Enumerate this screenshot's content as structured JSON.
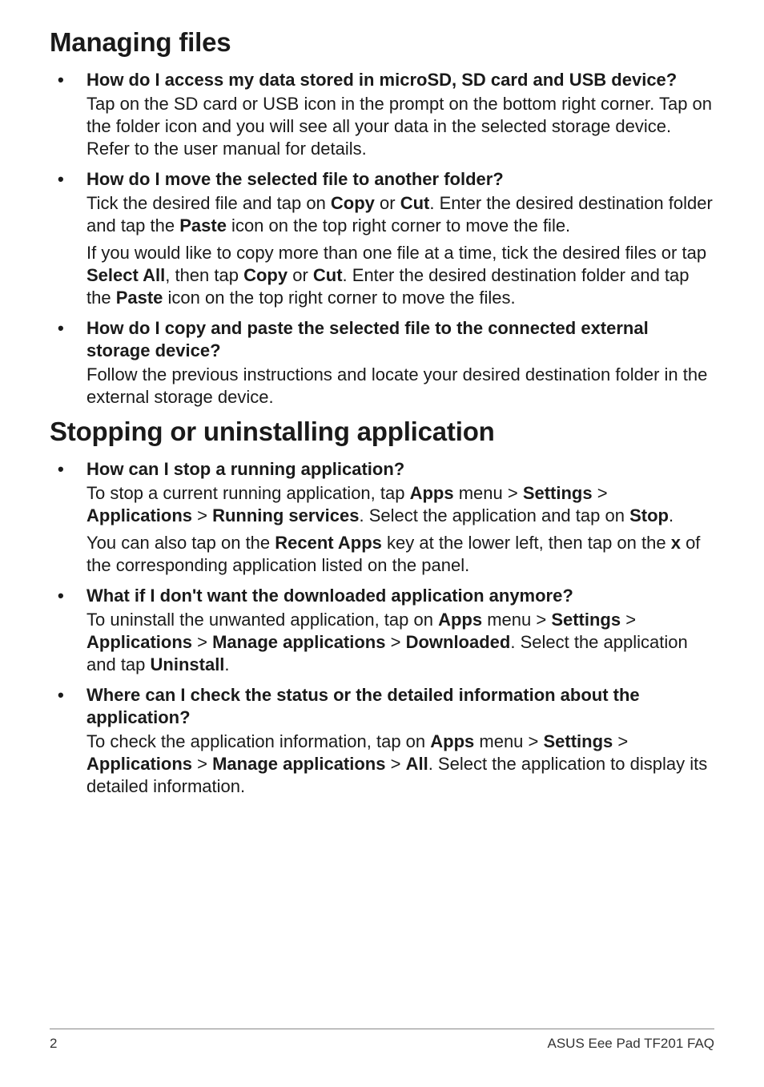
{
  "sections": [
    {
      "heading": "Managing files",
      "items": [
        {
          "q": "How do I access my data stored in microSD, SD card and USB device?",
          "paras": [
            [
              {
                "t": "Tap on the SD card or USB icon in the prompt on the bottom right corner. Tap on the folder icon and you will see all your data in the selected storage device. Refer to the user manual for details."
              }
            ]
          ]
        },
        {
          "q": "How do I move the selected file to another folder?",
          "paras": [
            [
              {
                "t": "Tick the desired file and tap on "
              },
              {
                "t": "Copy",
                "b": true
              },
              {
                "t": " or "
              },
              {
                "t": "Cut",
                "b": true
              },
              {
                "t": ". Enter the desired destination folder and tap the "
              },
              {
                "t": "Paste",
                "b": true
              },
              {
                "t": " icon on the top right corner to move the file."
              }
            ],
            [
              {
                "t": "If you would like to copy more than one file at a time, tick the desired files or tap "
              },
              {
                "t": "Select All",
                "b": true
              },
              {
                "t": ", then tap "
              },
              {
                "t": "Copy",
                "b": true
              },
              {
                "t": " or "
              },
              {
                "t": "Cut",
                "b": true
              },
              {
                "t": ". Enter the desired destination folder and tap the "
              },
              {
                "t": "Paste",
                "b": true
              },
              {
                "t": " icon on the top right corner to move the files."
              }
            ]
          ]
        },
        {
          "q": "How do I copy and paste the selected file to the connected external storage device?",
          "paras": [
            [
              {
                "t": "Follow the previous instructions and locate your desired destination folder in the external storage device."
              }
            ]
          ]
        }
      ]
    },
    {
      "heading": "Stopping or uninstalling application",
      "items": [
        {
          "q": "How can I stop a running application?",
          "paras": [
            [
              {
                "t": "To stop a current running application, tap "
              },
              {
                "t": "Apps",
                "b": true
              },
              {
                "t": " menu > "
              },
              {
                "t": "Settings",
                "b": true
              },
              {
                "t": " > "
              },
              {
                "t": "Applications",
                "b": true
              },
              {
                "t": " > "
              },
              {
                "t": "Running services",
                "b": true
              },
              {
                "t": ". Select the application and tap on "
              },
              {
                "t": "Stop",
                "b": true
              },
              {
                "t": "."
              }
            ],
            [
              {
                "t": "You can also tap on the "
              },
              {
                "t": "Recent Apps",
                "b": true
              },
              {
                "t": " key at the lower left, then tap on the "
              },
              {
                "t": "x",
                "b": true
              },
              {
                "t": " of the corresponding application listed on the panel."
              }
            ]
          ]
        },
        {
          "q": "What if I don't want the downloaded application anymore?",
          "paras": [
            [
              {
                "t": "To uninstall the unwanted application, tap on "
              },
              {
                "t": "Apps",
                "b": true
              },
              {
                "t": " menu > "
              },
              {
                "t": "Settings",
                "b": true
              },
              {
                "t": " > "
              },
              {
                "t": "Applications",
                "b": true
              },
              {
                "t": " > "
              },
              {
                "t": "Manage applications",
                "b": true
              },
              {
                "t": " > "
              },
              {
                "t": "Downloaded",
                "b": true
              },
              {
                "t": ". Select the application and tap "
              },
              {
                "t": "Uninstall",
                "b": true
              },
              {
                "t": "."
              }
            ]
          ]
        },
        {
          "q": "Where can I check the status or the detailed information about the application?",
          "paras": [
            [
              {
                "t": "To check the application information, tap on "
              },
              {
                "t": "Apps",
                "b": true
              },
              {
                "t": " menu > "
              },
              {
                "t": "Settings",
                "b": true
              },
              {
                "t": " > "
              },
              {
                "t": "Applications",
                "b": true
              },
              {
                "t": " > "
              },
              {
                "t": "Manage applications",
                "b": true
              },
              {
                "t": " > "
              },
              {
                "t": "All",
                "b": true
              },
              {
                "t": ". Select the application to display its detailed information."
              }
            ]
          ]
        }
      ]
    }
  ],
  "footer": {
    "page_number": "2",
    "product": "ASUS Eee Pad TF201 FAQ"
  }
}
